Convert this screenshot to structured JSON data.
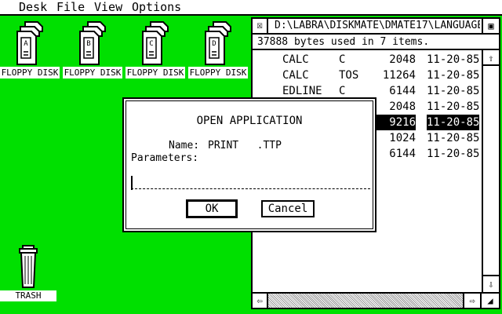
{
  "menubar": {
    "items": [
      "Desk",
      "File",
      "View",
      "Options"
    ]
  },
  "desktop": {
    "disks": [
      {
        "letter": "A",
        "label": "FLOPPY DISK"
      },
      {
        "letter": "B",
        "label": "FLOPPY DISK"
      },
      {
        "letter": "C",
        "label": "FLOPPY DISK"
      },
      {
        "letter": "D",
        "label": "FLOPPY DISK"
      }
    ],
    "trash_label": "TRASH"
  },
  "window": {
    "path": "D:\\LABRA\\DISKMATE\\DMATE17\\LANGUAGE\\",
    "info": "37888 bytes used in 7 items.",
    "files": [
      {
        "name": "CALC",
        "ext": "C",
        "size": "2048",
        "date": "11-20-85"
      },
      {
        "name": "CALC",
        "ext": "TOS",
        "size": "11264",
        "date": "11-20-85"
      },
      {
        "name": "EDLINE",
        "ext": "C",
        "size": "6144",
        "date": "11-20-85"
      },
      {
        "name": "",
        "ext": "",
        "size": "2048",
        "date": "11-20-85"
      },
      {
        "name": "",
        "ext": "",
        "size": "9216",
        "date": "11-20-85",
        "selected": true
      },
      {
        "name": "",
        "ext": "",
        "size": "1024",
        "date": "11-20-85"
      },
      {
        "name": "",
        "ext": "",
        "size": "6144",
        "date": "11-20-85"
      }
    ]
  },
  "dialog": {
    "title": "OPEN APPLICATION",
    "name_label": "Name:",
    "name_value": "PRINT   .TTP",
    "params_label": "Parameters:",
    "params_value": "",
    "ok_label": "OK",
    "cancel_label": "Cancel"
  }
}
